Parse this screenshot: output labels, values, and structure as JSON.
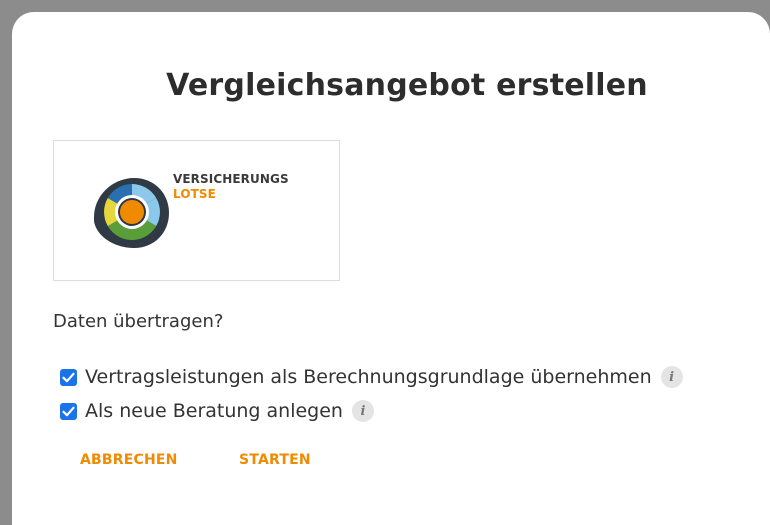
{
  "dialog": {
    "title": "Vergleichsangebot erstellen",
    "logo": {
      "line1": "VERSICHERUNGS",
      "line2": "LOTSE",
      "colors": {
        "ring_dark": "#2f3a44",
        "orange": "#f08a00",
        "blue": "#2a6fb0",
        "light_blue": "#8cc8ea",
        "green": "#5a9e3a",
        "yellow": "#e6d83c"
      }
    },
    "question": "Daten übertragen?",
    "options": [
      {
        "label": "Vertragsleistungen als Berechnungsgrundlage übernehmen",
        "checked": true,
        "info_icon": "info-icon"
      },
      {
        "label": "Als neue Beratung anlegen",
        "checked": true,
        "info_icon": "info-icon"
      }
    ],
    "buttons": {
      "cancel": "ABBRECHEN",
      "start": "STARTEN"
    },
    "colors": {
      "accent": "#f08a00",
      "checkbox": "#1a73e8"
    }
  }
}
